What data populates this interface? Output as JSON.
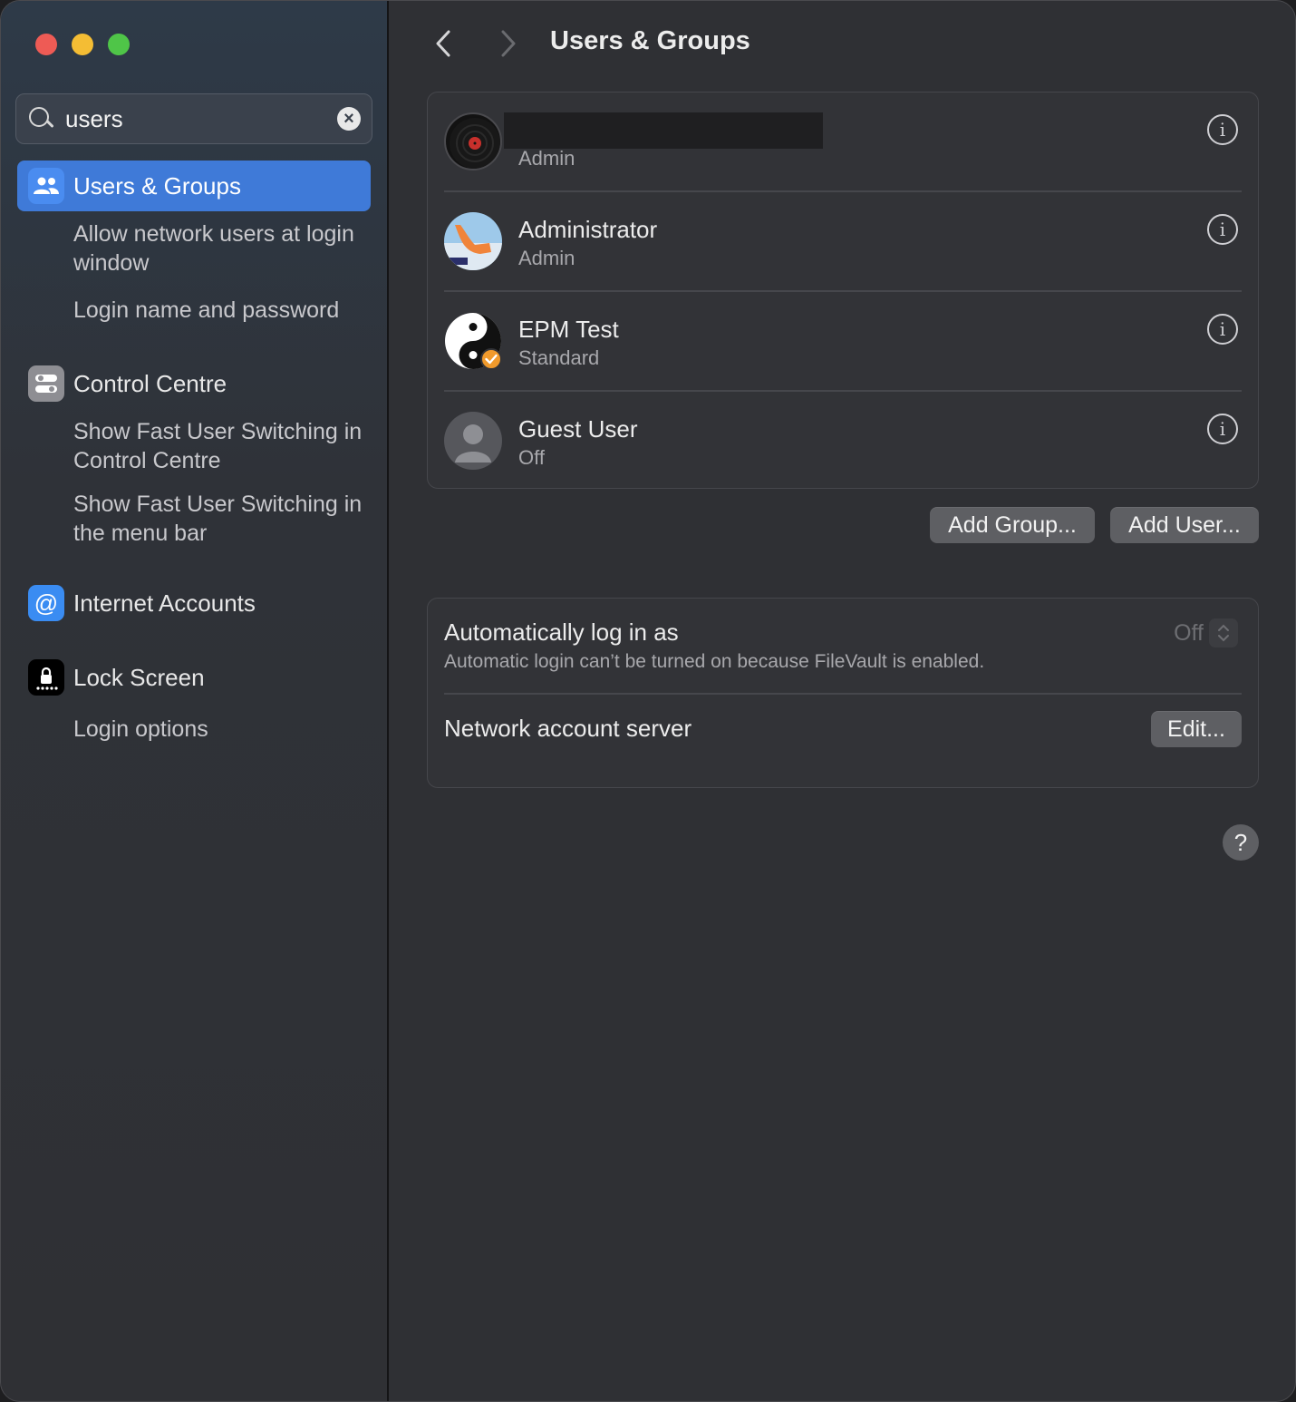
{
  "sidebar": {
    "search": {
      "query": "users",
      "clear_icon": "×"
    },
    "items": [
      {
        "label": "Users & Groups",
        "icon": "users-icon",
        "active": true
      },
      {
        "label": "Control Centre",
        "icon": "control-centre-icon"
      },
      {
        "label": "Internet Accounts",
        "icon": "at-icon",
        "glyph": "@"
      },
      {
        "label": "Lock Screen",
        "icon": "lock-icon"
      }
    ],
    "sub_items": {
      "users_groups": [
        "Allow network users at login window",
        "Login name and password"
      ],
      "control_centre": [
        "Show Fast User Switching in Control Centre",
        "Show Fast User Switching in the menu bar"
      ],
      "lock_screen": [
        "Login options"
      ]
    }
  },
  "header": {
    "title": "Users & Groups",
    "back_icon": "chevron-left-icon",
    "forward_icon": "chevron-right-icon"
  },
  "users": [
    {
      "name": "",
      "role": "Admin",
      "redacted": true
    },
    {
      "name": "Administrator",
      "role": "Admin"
    },
    {
      "name": "EPM Test",
      "role": "Standard"
    },
    {
      "name": "Guest User",
      "role": "Off"
    }
  ],
  "buttons": {
    "add_group": "Add Group...",
    "add_user": "Add User...",
    "edit": "Edit...",
    "help": "?"
  },
  "auto_login": {
    "title": "Automatically log in as",
    "subtitle": "Automatic login can’t be turned on because FileVault is enabled.",
    "value": "Off"
  },
  "network_server": {
    "title": "Network account server"
  },
  "colors": {
    "accent": "#3f7ad8",
    "window_bg": "#2f3034",
    "card_bg": "#323337"
  }
}
